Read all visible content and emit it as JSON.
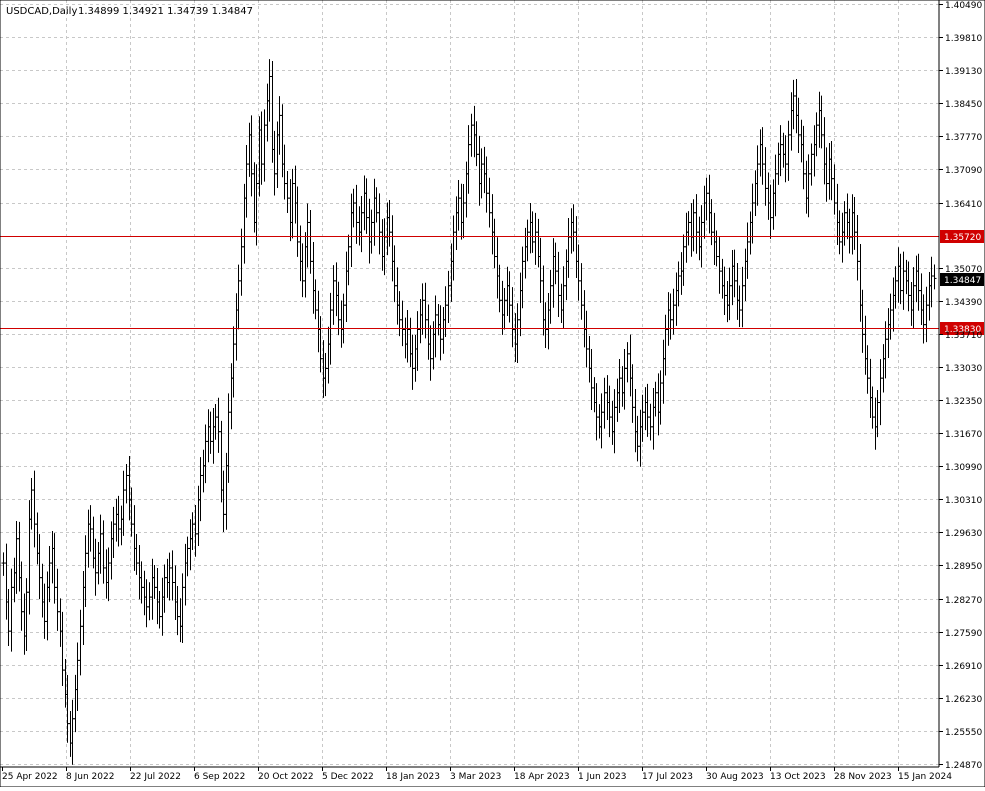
{
  "header": {
    "symbol_label": "USDCAD,Daily",
    "ohlc_label": "1.34899 1.34921 1.34739 1.34847"
  },
  "price_axis": {
    "ticks": [
      "1.40490",
      "1.39810",
      "1.39130",
      "1.38450",
      "1.37770",
      "1.37090",
      "1.36410",
      "1.35070",
      "1.34390",
      "1.33710",
      "1.33030",
      "1.32350",
      "1.31670",
      "1.30990",
      "1.30310",
      "1.29630",
      "1.28950",
      "1.28270",
      "1.27590",
      "1.26910",
      "1.26230",
      "1.25550",
      "1.24870"
    ],
    "current_price": "1.34847",
    "current_price_bg": "#000000"
  },
  "time_axis": {
    "labels": [
      "25 Apr 2022",
      "8 Jun 2022",
      "22 Jul 2022",
      "6 Sep 2022",
      "20 Oct 2022",
      "5 Dec 2022",
      "18 Jan 2023",
      "3 Mar 2023",
      "18 Apr 2023",
      "1 Jun 2023",
      "17 Jul 2023",
      "30 Aug 2023",
      "13 Oct 2023",
      "28 Nov 2023",
      "15 Jan 2024"
    ]
  },
  "levels": [
    {
      "value": 1.3572,
      "label": "1.35720",
      "color": "#d00000"
    },
    {
      "value": 1.3383,
      "label": "1.33830",
      "color": "#d00000"
    }
  ],
  "chart_data": {
    "type": "ohlc",
    "title": "USDCAD,Daily",
    "ylim": [
      1.2487,
      1.4049
    ],
    "grid": true,
    "bar_color": "#000000",
    "close_series": [
      1.29,
      1.282,
      1.276,
      1.285,
      1.288,
      1.295,
      1.287,
      1.28,
      1.275,
      1.284,
      1.299,
      1.305,
      1.298,
      1.292,
      1.287,
      1.282,
      1.278,
      1.285,
      1.29,
      1.293,
      1.285,
      1.28,
      1.276,
      1.268,
      1.263,
      1.257,
      1.253,
      1.258,
      1.264,
      1.27,
      1.277,
      1.285,
      1.292,
      1.298,
      1.297,
      1.291,
      1.288,
      1.292,
      1.296,
      1.289,
      1.286,
      1.29,
      1.295,
      1.298,
      1.3,
      1.297,
      1.299,
      1.305,
      1.308,
      1.303,
      1.298,
      1.293,
      1.29,
      1.287,
      1.285,
      1.283,
      1.281,
      1.283,
      1.287,
      1.285,
      1.282,
      1.279,
      1.283,
      1.287,
      1.286,
      1.289,
      1.286,
      1.282,
      1.279,
      1.277,
      1.285,
      1.29,
      1.293,
      1.295,
      1.298,
      1.296,
      1.303,
      1.308,
      1.31,
      1.315,
      1.318,
      1.315,
      1.318,
      1.32,
      1.317,
      1.305,
      1.3,
      1.31,
      1.321,
      1.328,
      1.335,
      1.342,
      1.348,
      1.355,
      1.365,
      1.372,
      1.378,
      1.37,
      1.36,
      1.368,
      1.379,
      1.372,
      1.38,
      1.385,
      1.39,
      1.375,
      1.37,
      1.378,
      1.382,
      1.372,
      1.368,
      1.365,
      1.36,
      1.368,
      1.364,
      1.356,
      1.352,
      1.348,
      1.355,
      1.36,
      1.352,
      1.346,
      1.342,
      1.338,
      1.332,
      1.328,
      1.33,
      1.335,
      1.342,
      1.348,
      1.345,
      1.34,
      1.338,
      1.343,
      1.35,
      1.355,
      1.362,
      1.364,
      1.36,
      1.358,
      1.362,
      1.366,
      1.361,
      1.356,
      1.36,
      1.365,
      1.362,
      1.358,
      1.353,
      1.357,
      1.361,
      1.358,
      1.352,
      1.347,
      1.343,
      1.34,
      1.338,
      1.335,
      1.338,
      1.333,
      1.33,
      1.334,
      1.338,
      1.341,
      1.344,
      1.34,
      1.335,
      1.332,
      1.337,
      1.341,
      1.339,
      1.336,
      1.34,
      1.343,
      1.347,
      1.352,
      1.358,
      1.362,
      1.365,
      1.36,
      1.364,
      1.37,
      1.376,
      1.38,
      1.378,
      1.374,
      1.368,
      1.372,
      1.37,
      1.366,
      1.362,
      1.358,
      1.353,
      1.349,
      1.344,
      1.341,
      1.344,
      1.347,
      1.343,
      1.338,
      1.335,
      1.34,
      1.346,
      1.352,
      1.355,
      1.358,
      1.36,
      1.356,
      1.358,
      1.353,
      1.348,
      1.34,
      1.338,
      1.342,
      1.347,
      1.353,
      1.35,
      1.345,
      1.342,
      1.347,
      1.352,
      1.357,
      1.36,
      1.358,
      1.352,
      1.348,
      1.343,
      1.338,
      1.334,
      1.33,
      1.326,
      1.323,
      1.32,
      1.318,
      1.321,
      1.325,
      1.323,
      1.32,
      1.317,
      1.322,
      1.325,
      1.328,
      1.325,
      1.33,
      1.333,
      1.328,
      1.322,
      1.317,
      1.314,
      1.318,
      1.321,
      1.323,
      1.32,
      1.318,
      1.322,
      1.325,
      1.321,
      1.327,
      1.332,
      1.338,
      1.342,
      1.34,
      1.343,
      1.346,
      1.349,
      1.35,
      1.355,
      1.358,
      1.36,
      1.357,
      1.362,
      1.358,
      1.355,
      1.36,
      1.364,
      1.366,
      1.362,
      1.358,
      1.356,
      1.353,
      1.35,
      1.347,
      1.345,
      1.343,
      1.347,
      1.351,
      1.348,
      1.344,
      1.342,
      1.347,
      1.352,
      1.356,
      1.36,
      1.364,
      1.368,
      1.372,
      1.376,
      1.372,
      1.367,
      1.364,
      1.361,
      1.366,
      1.37,
      1.374,
      1.376,
      1.374,
      1.372,
      1.378,
      1.383,
      1.386,
      1.382,
      1.378,
      1.376,
      1.37,
      1.365,
      1.37,
      1.374,
      1.376,
      1.38,
      1.383,
      1.378,
      1.372,
      1.368,
      1.373,
      1.369,
      1.364,
      1.36,
      1.356,
      1.358,
      1.362,
      1.36,
      1.357,
      1.362,
      1.358,
      1.352,
      1.343,
      1.337,
      1.332,
      1.328,
      1.324,
      1.32,
      1.318,
      1.323,
      1.328,
      1.332,
      1.336,
      1.339,
      1.342,
      1.345,
      1.348,
      1.351,
      1.346,
      1.35,
      1.348,
      1.345,
      1.342,
      1.347,
      1.35,
      1.346,
      1.342,
      1.339,
      1.343,
      1.347,
      1.349,
      1.3485
    ]
  }
}
